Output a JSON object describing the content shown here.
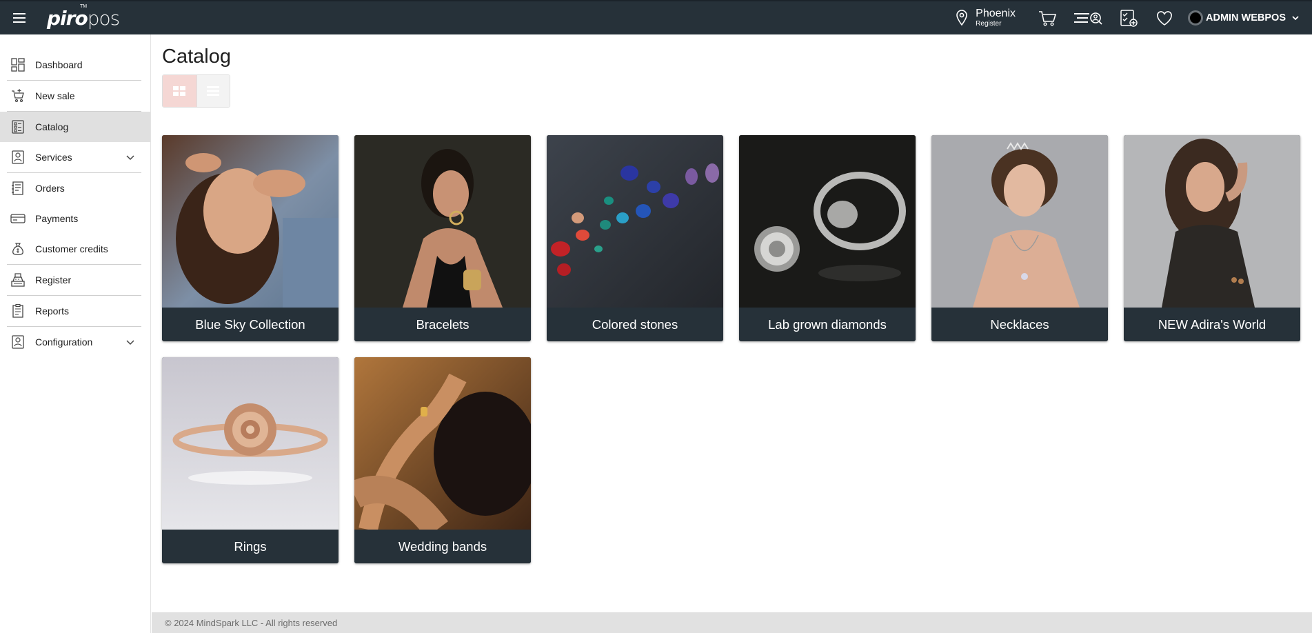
{
  "header": {
    "logo_bold": "piro",
    "logo_light": "pos",
    "logo_tm": "TM",
    "location_name": "Phoenix",
    "location_sub": "Register",
    "user_name": "ADMIN WEBPOS",
    "icons": [
      "menu-icon",
      "location-pin-icon",
      "cart-icon",
      "customer-search-icon",
      "task-add-icon",
      "heart-icon",
      "user-avatar",
      "chevron-down-icon"
    ]
  },
  "sidebar": {
    "items": [
      {
        "label": "Dashboard",
        "icon": "dashboard-icon"
      },
      {
        "label": "New sale",
        "icon": "new-sale-cart-icon"
      },
      {
        "label": "Catalog",
        "icon": "catalog-icon",
        "active": true
      },
      {
        "label": "Services",
        "icon": "services-icon",
        "expandable": true
      },
      {
        "label": "Orders",
        "icon": "orders-icon"
      },
      {
        "label": "Payments",
        "icon": "payments-card-icon"
      },
      {
        "label": "Customer credits",
        "icon": "money-bag-icon"
      },
      {
        "label": "Register",
        "icon": "register-icon"
      },
      {
        "label": "Reports",
        "icon": "reports-icon"
      },
      {
        "label": "Configuration",
        "icon": "configuration-icon",
        "expandable": true
      }
    ]
  },
  "main": {
    "title": "Catalog",
    "view_toggle": {
      "active": "grid",
      "options": [
        "grid-view-icon",
        "list-view-icon"
      ]
    },
    "categories": [
      {
        "label": "Blue Sky Collection"
      },
      {
        "label": "Bracelets"
      },
      {
        "label": "Colored stones"
      },
      {
        "label": "Lab grown diamonds"
      },
      {
        "label": "Necklaces"
      },
      {
        "label": "NEW Adira's World"
      },
      {
        "label": "Rings"
      },
      {
        "label": "Wedding bands"
      }
    ]
  },
  "footer": {
    "text": "© 2024 MindSpark LLC - All rights reserved"
  },
  "colors": {
    "topbar": "#263139",
    "caption_bg": "#263139",
    "active_nav": "#e0e0e0",
    "grid_toggle_active": "#f5d7d4"
  }
}
